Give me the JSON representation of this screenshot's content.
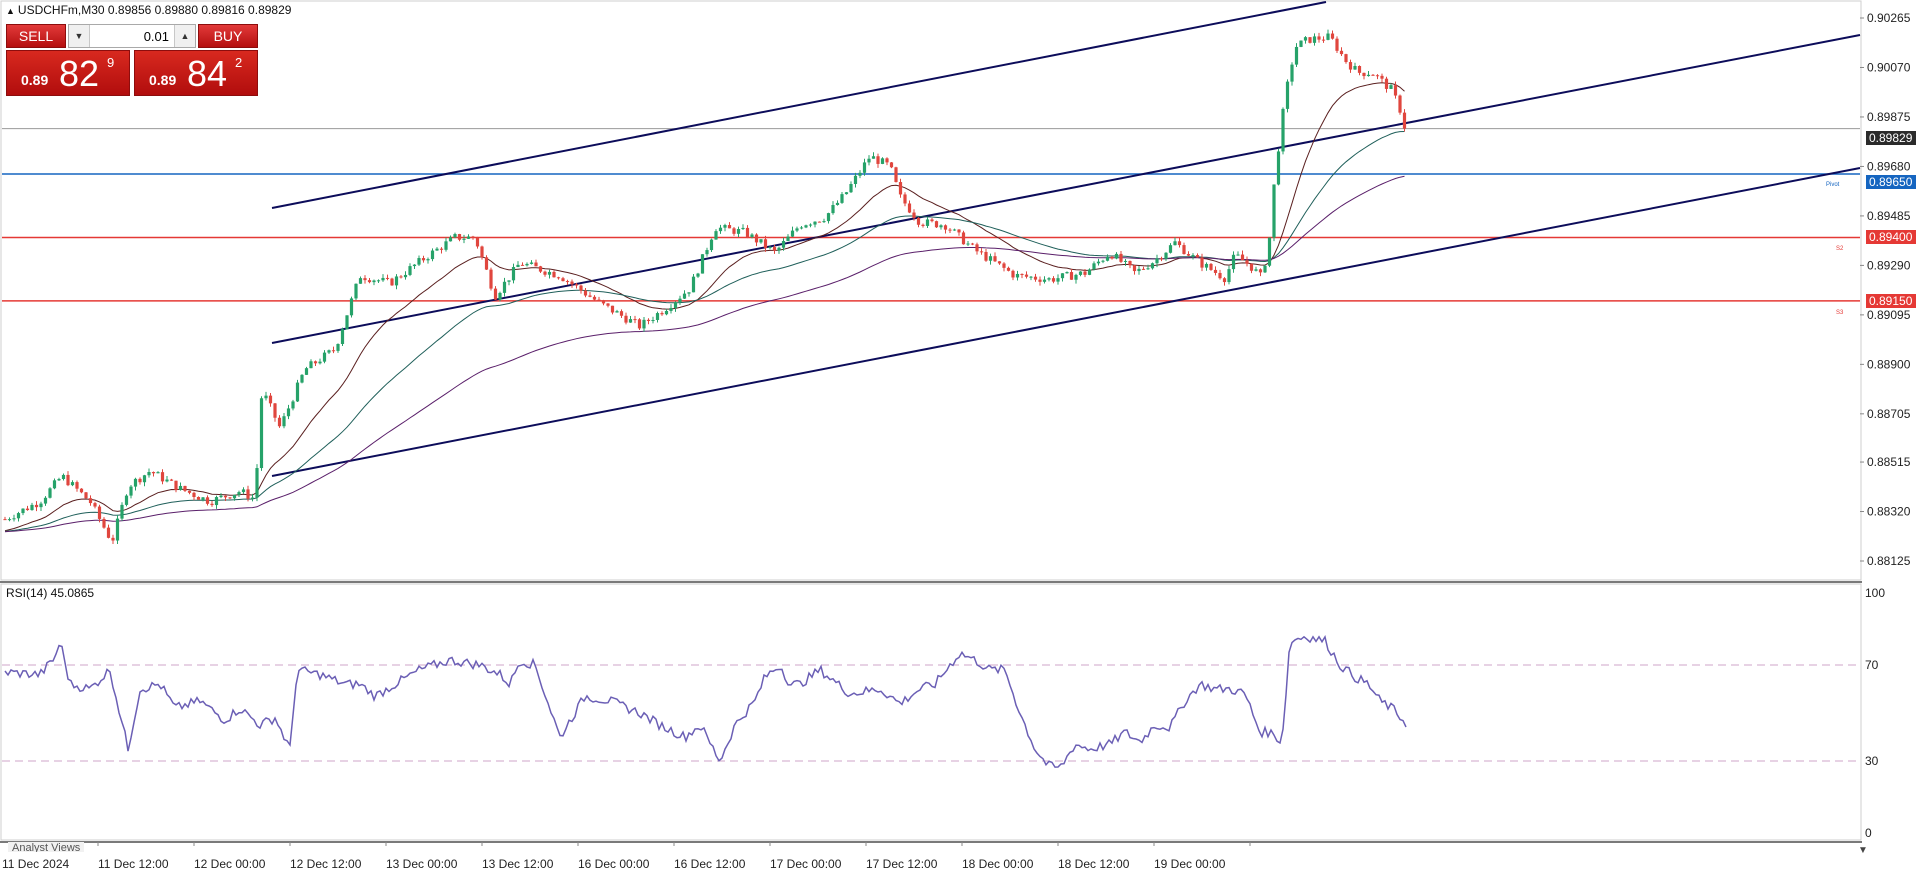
{
  "header": {
    "symbol_line": "USDCHFm,M30  0.89856 0.89880 0.89816 0.89829"
  },
  "trade_panel": {
    "sell_label": "SELL",
    "buy_label": "BUY",
    "lot_value": "0.01",
    "sell_prefix": "0.89",
    "sell_big": "82",
    "sell_sup": "9",
    "buy_prefix": "0.89",
    "buy_big": "84",
    "buy_sup": "2"
  },
  "price_axis": [
    "0.90265",
    "0.90070",
    "0.89875",
    "0.89680",
    "0.89485",
    "0.89290",
    "0.89095",
    "0.88900",
    "0.88705",
    "0.88515",
    "0.88320",
    "0.88125"
  ],
  "price_labels": {
    "current": "0.89829",
    "pivot": "0.89650",
    "s2": "0.89400",
    "s3": "0.89150"
  },
  "level_tags": {
    "pivot": "Pivot",
    "s2": "S2",
    "s3": "S3"
  },
  "time_axis": [
    "11 Dec 2024",
    "11 Dec 12:00",
    "12 Dec 00:00",
    "12 Dec 12:00",
    "13 Dec 00:00",
    "13 Dec 12:00",
    "16 Dec 00:00",
    "16 Dec 12:00",
    "17 Dec 00:00",
    "17 Dec 12:00",
    "18 Dec 00:00",
    "18 Dec 12:00",
    "19 Dec 00:00"
  ],
  "indicator": {
    "label": "RSI(14) 45.0865",
    "scale": [
      "100",
      "70",
      "30",
      "0"
    ],
    "levels": [
      70,
      30
    ]
  },
  "bottom_tab": "Analyst Views",
  "colors": {
    "bull": "#26a269",
    "bear": "#e0463e",
    "pivot": "#1565c0",
    "support": "#e53935",
    "channel": "#0c0c5a",
    "rsi": "#6b5fb5"
  }
}
